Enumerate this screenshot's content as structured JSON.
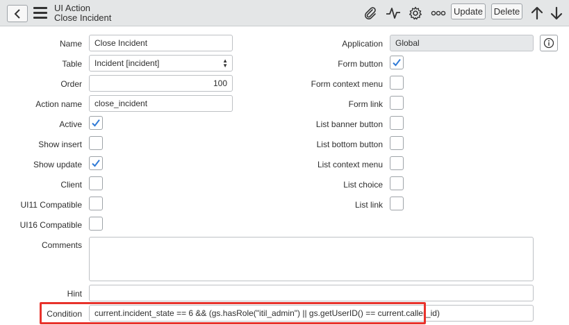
{
  "header": {
    "record_type": "UI Action",
    "record_name": "Close Incident",
    "update_label": "Update",
    "delete_label": "Delete",
    "icons": [
      "back-icon",
      "hamburger-menu-icon",
      "paperclip-icon",
      "activity-pulse-icon",
      "gear-icon",
      "more-options-icon",
      "arrow-up-icon",
      "arrow-down-icon"
    ]
  },
  "form": {
    "name": {
      "label": "Name",
      "value": "Close Incident"
    },
    "table": {
      "label": "Table",
      "value": "Incident [incident]"
    },
    "order": {
      "label": "Order",
      "value": "100"
    },
    "action_name": {
      "label": "Action name",
      "value": "close_incident"
    },
    "active": {
      "label": "Active",
      "checked": true
    },
    "show_insert": {
      "label": "Show insert",
      "checked": false
    },
    "show_update": {
      "label": "Show update",
      "checked": true
    },
    "client": {
      "label": "Client",
      "checked": false
    },
    "ui11": {
      "label": "UI11 Compatible",
      "checked": false
    },
    "ui16": {
      "label": "UI16 Compatible",
      "checked": false
    },
    "application": {
      "label": "Application",
      "value": "Global"
    },
    "form_button": {
      "label": "Form button",
      "checked": true
    },
    "form_context_menu": {
      "label": "Form context menu",
      "checked": false
    },
    "form_link": {
      "label": "Form link",
      "checked": false
    },
    "list_banner_button": {
      "label": "List banner button",
      "checked": false
    },
    "list_bottom_button": {
      "label": "List bottom button",
      "checked": false
    },
    "list_context_menu": {
      "label": "List context menu",
      "checked": false
    },
    "list_choice": {
      "label": "List choice",
      "checked": false
    },
    "list_link": {
      "label": "List link",
      "checked": false
    },
    "comments": {
      "label": "Comments",
      "value": ""
    },
    "hint": {
      "label": "Hint",
      "value": ""
    },
    "condition": {
      "label": "Condition",
      "value": "current.incident_state == 6 && (gs.hasRole(\"itil_admin\") || gs.getUserID() == current.caller_id)"
    }
  },
  "colors": {
    "check": "#2f7ad6",
    "highlight": "#e8322b",
    "header_bg": "#e4e6e7"
  }
}
